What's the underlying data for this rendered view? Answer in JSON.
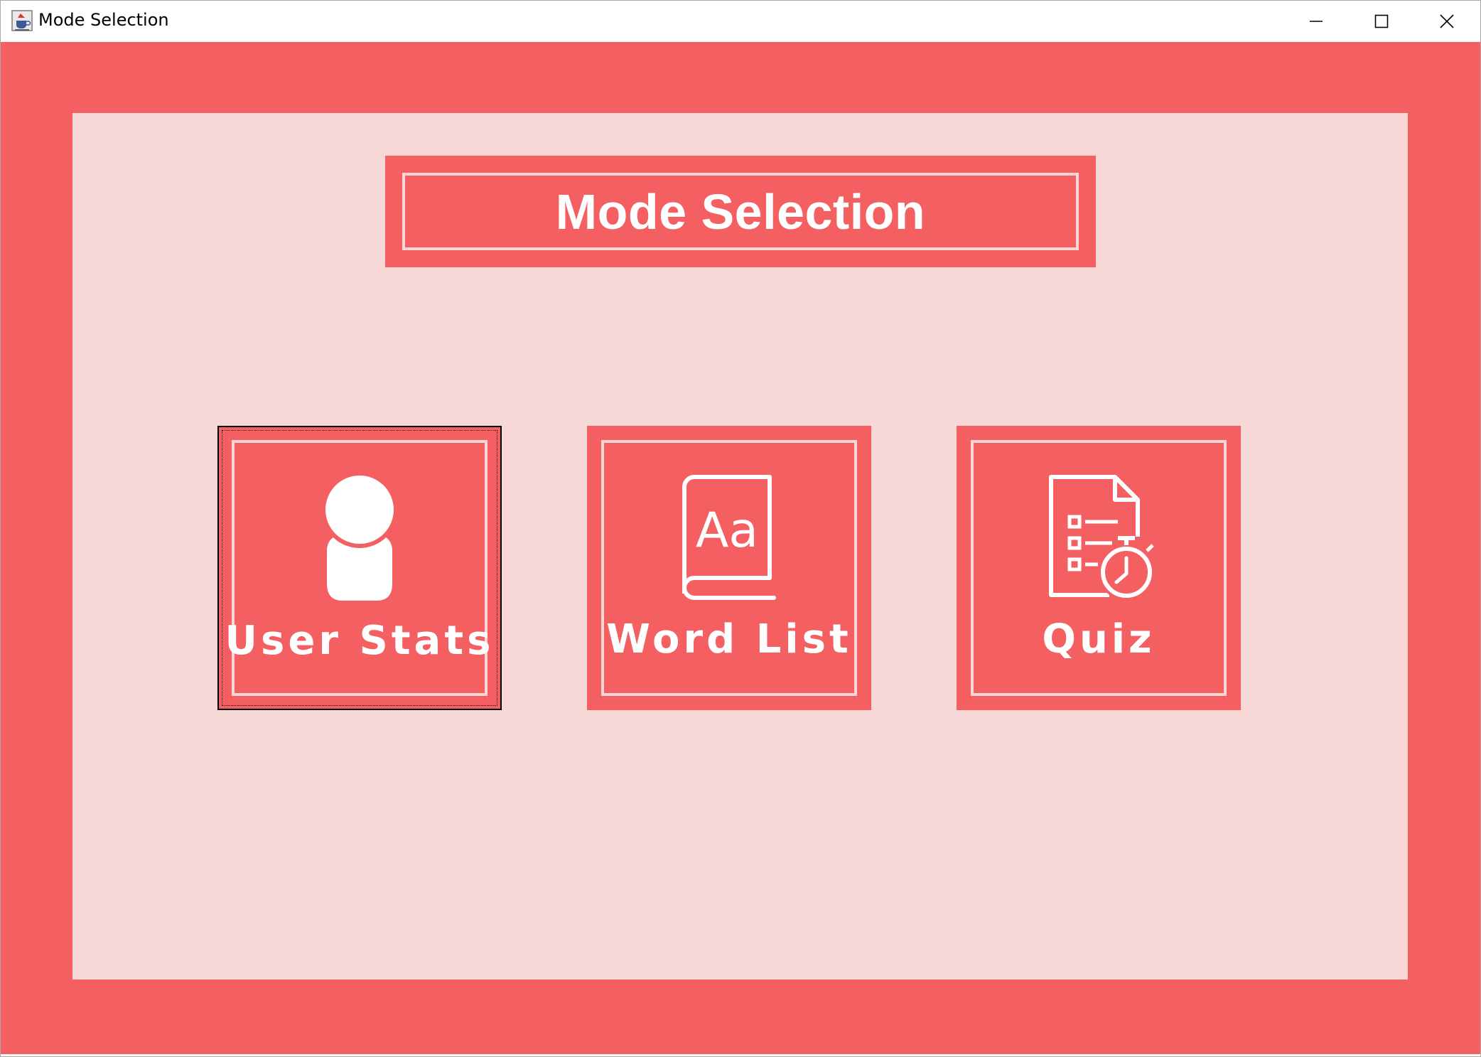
{
  "window": {
    "title": "Mode Selection",
    "icon": "java-coffee-cup-icon",
    "controls": [
      "minimize-icon",
      "maximize-icon",
      "close-icon"
    ]
  },
  "colors": {
    "background": "#f45f62",
    "panel": "#f8d7d7",
    "frame": "#fbd6d6",
    "text": "#ffffff"
  },
  "header": {
    "title": "Mode Selection"
  },
  "modes": [
    {
      "label": "User Stats",
      "icon": "user-icon",
      "focused": true
    },
    {
      "label": "Word List",
      "icon": "dictionary-book-icon",
      "focused": false
    },
    {
      "label": "Quiz",
      "icon": "quiz-timer-icon",
      "focused": false
    }
  ]
}
